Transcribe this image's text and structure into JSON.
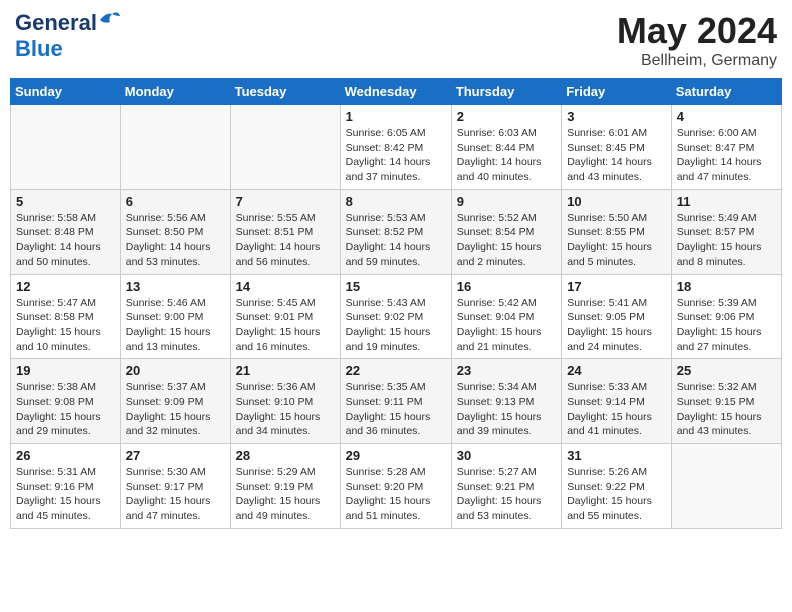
{
  "header": {
    "logo_general": "General",
    "logo_blue": "Blue",
    "month": "May 2024",
    "location": "Bellheim, Germany"
  },
  "weekdays": [
    "Sunday",
    "Monday",
    "Tuesday",
    "Wednesday",
    "Thursday",
    "Friday",
    "Saturday"
  ],
  "weeks": [
    [
      {
        "day": "",
        "info": ""
      },
      {
        "day": "",
        "info": ""
      },
      {
        "day": "",
        "info": ""
      },
      {
        "day": "1",
        "info": "Sunrise: 6:05 AM\nSunset: 8:42 PM\nDaylight: 14 hours\nand 37 minutes."
      },
      {
        "day": "2",
        "info": "Sunrise: 6:03 AM\nSunset: 8:44 PM\nDaylight: 14 hours\nand 40 minutes."
      },
      {
        "day": "3",
        "info": "Sunrise: 6:01 AM\nSunset: 8:45 PM\nDaylight: 14 hours\nand 43 minutes."
      },
      {
        "day": "4",
        "info": "Sunrise: 6:00 AM\nSunset: 8:47 PM\nDaylight: 14 hours\nand 47 minutes."
      }
    ],
    [
      {
        "day": "5",
        "info": "Sunrise: 5:58 AM\nSunset: 8:48 PM\nDaylight: 14 hours\nand 50 minutes."
      },
      {
        "day": "6",
        "info": "Sunrise: 5:56 AM\nSunset: 8:50 PM\nDaylight: 14 hours\nand 53 minutes."
      },
      {
        "day": "7",
        "info": "Sunrise: 5:55 AM\nSunset: 8:51 PM\nDaylight: 14 hours\nand 56 minutes."
      },
      {
        "day": "8",
        "info": "Sunrise: 5:53 AM\nSunset: 8:52 PM\nDaylight: 14 hours\nand 59 minutes."
      },
      {
        "day": "9",
        "info": "Sunrise: 5:52 AM\nSunset: 8:54 PM\nDaylight: 15 hours\nand 2 minutes."
      },
      {
        "day": "10",
        "info": "Sunrise: 5:50 AM\nSunset: 8:55 PM\nDaylight: 15 hours\nand 5 minutes."
      },
      {
        "day": "11",
        "info": "Sunrise: 5:49 AM\nSunset: 8:57 PM\nDaylight: 15 hours\nand 8 minutes."
      }
    ],
    [
      {
        "day": "12",
        "info": "Sunrise: 5:47 AM\nSunset: 8:58 PM\nDaylight: 15 hours\nand 10 minutes."
      },
      {
        "day": "13",
        "info": "Sunrise: 5:46 AM\nSunset: 9:00 PM\nDaylight: 15 hours\nand 13 minutes."
      },
      {
        "day": "14",
        "info": "Sunrise: 5:45 AM\nSunset: 9:01 PM\nDaylight: 15 hours\nand 16 minutes."
      },
      {
        "day": "15",
        "info": "Sunrise: 5:43 AM\nSunset: 9:02 PM\nDaylight: 15 hours\nand 19 minutes."
      },
      {
        "day": "16",
        "info": "Sunrise: 5:42 AM\nSunset: 9:04 PM\nDaylight: 15 hours\nand 21 minutes."
      },
      {
        "day": "17",
        "info": "Sunrise: 5:41 AM\nSunset: 9:05 PM\nDaylight: 15 hours\nand 24 minutes."
      },
      {
        "day": "18",
        "info": "Sunrise: 5:39 AM\nSunset: 9:06 PM\nDaylight: 15 hours\nand 27 minutes."
      }
    ],
    [
      {
        "day": "19",
        "info": "Sunrise: 5:38 AM\nSunset: 9:08 PM\nDaylight: 15 hours\nand 29 minutes."
      },
      {
        "day": "20",
        "info": "Sunrise: 5:37 AM\nSunset: 9:09 PM\nDaylight: 15 hours\nand 32 minutes."
      },
      {
        "day": "21",
        "info": "Sunrise: 5:36 AM\nSunset: 9:10 PM\nDaylight: 15 hours\nand 34 minutes."
      },
      {
        "day": "22",
        "info": "Sunrise: 5:35 AM\nSunset: 9:11 PM\nDaylight: 15 hours\nand 36 minutes."
      },
      {
        "day": "23",
        "info": "Sunrise: 5:34 AM\nSunset: 9:13 PM\nDaylight: 15 hours\nand 39 minutes."
      },
      {
        "day": "24",
        "info": "Sunrise: 5:33 AM\nSunset: 9:14 PM\nDaylight: 15 hours\nand 41 minutes."
      },
      {
        "day": "25",
        "info": "Sunrise: 5:32 AM\nSunset: 9:15 PM\nDaylight: 15 hours\nand 43 minutes."
      }
    ],
    [
      {
        "day": "26",
        "info": "Sunrise: 5:31 AM\nSunset: 9:16 PM\nDaylight: 15 hours\nand 45 minutes."
      },
      {
        "day": "27",
        "info": "Sunrise: 5:30 AM\nSunset: 9:17 PM\nDaylight: 15 hours\nand 47 minutes."
      },
      {
        "day": "28",
        "info": "Sunrise: 5:29 AM\nSunset: 9:19 PM\nDaylight: 15 hours\nand 49 minutes."
      },
      {
        "day": "29",
        "info": "Sunrise: 5:28 AM\nSunset: 9:20 PM\nDaylight: 15 hours\nand 51 minutes."
      },
      {
        "day": "30",
        "info": "Sunrise: 5:27 AM\nSunset: 9:21 PM\nDaylight: 15 hours\nand 53 minutes."
      },
      {
        "day": "31",
        "info": "Sunrise: 5:26 AM\nSunset: 9:22 PM\nDaylight: 15 hours\nand 55 minutes."
      },
      {
        "day": "",
        "info": ""
      }
    ]
  ]
}
